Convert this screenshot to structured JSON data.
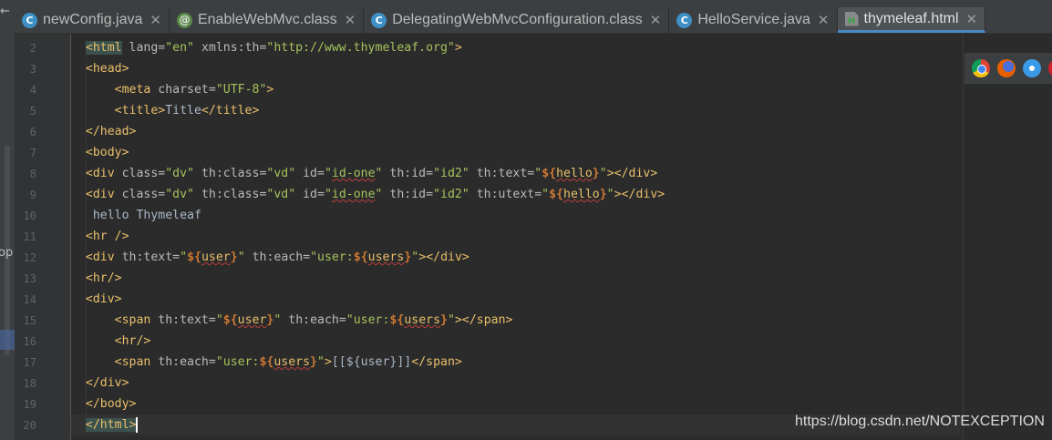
{
  "left_panel": {
    "arrow": "←",
    "cut_text": "op"
  },
  "tabs": [
    {
      "icon": "C",
      "icon_type": "class-c",
      "label": "newConfig.java",
      "close": "✕",
      "active": false
    },
    {
      "icon": "@",
      "icon_type": "anno",
      "label": "EnableWebMvc.class",
      "close": "✕",
      "active": false
    },
    {
      "icon": "C",
      "icon_type": "class-c",
      "label": "DelegatingWebMvcConfiguration.class",
      "close": "✕",
      "active": false
    },
    {
      "icon": "C",
      "icon_type": "class-c",
      "label": "HelloService.java",
      "close": "✕",
      "active": false
    },
    {
      "icon": "H",
      "icon_type": "html-h",
      "label": "thymeleaf.html",
      "close": "✕",
      "active": true
    }
  ],
  "editor": {
    "lines": [
      {
        "no": "2",
        "indent": 1,
        "tokens": [
          [
            "tag",
            "<html"
          ],
          [
            "attr",
            " lang="
          ],
          [
            "val",
            "\"en\""
          ],
          [
            "attr",
            " xmlns:th="
          ],
          [
            "val",
            "\"http://www.thymeleaf.org\""
          ],
          [
            "tag",
            ">"
          ]
        ],
        "match": 0
      },
      {
        "no": "3",
        "indent": 1,
        "tokens": [
          [
            "tag",
            "<head>"
          ]
        ]
      },
      {
        "no": "4",
        "indent": 2,
        "tokens": [
          [
            "tag",
            "<meta"
          ],
          [
            "attr",
            " charset="
          ],
          [
            "val",
            "\"UTF-8\""
          ],
          [
            "tag",
            ">"
          ]
        ]
      },
      {
        "no": "5",
        "indent": 2,
        "tokens": [
          [
            "tag",
            "<title>"
          ],
          [
            "txt",
            "Title"
          ],
          [
            "tag",
            "</title>"
          ]
        ]
      },
      {
        "no": "6",
        "indent": 1,
        "tokens": [
          [
            "tag",
            "</head>"
          ]
        ]
      },
      {
        "no": "7",
        "indent": 1,
        "tokens": [
          [
            "tag",
            "<body>"
          ]
        ]
      },
      {
        "no": "8",
        "indent": 1,
        "tokens": [
          [
            "tag",
            "<div"
          ],
          [
            "attr",
            " class="
          ],
          [
            "val",
            "\"dv\""
          ],
          [
            "attr",
            " th:class="
          ],
          [
            "val",
            "\"vd\""
          ],
          [
            "attr",
            " id="
          ],
          [
            "val",
            "\""
          ],
          [
            "err",
            "id-one"
          ],
          [
            "val",
            "\""
          ],
          [
            "attr",
            " th:id="
          ],
          [
            "val",
            "\"id2\""
          ],
          [
            "attr",
            " th:text="
          ],
          [
            "val",
            "\""
          ],
          [
            "expr",
            "${"
          ],
          [
            "var",
            "hello"
          ],
          [
            "expr",
            "}"
          ],
          [
            "val",
            "\""
          ],
          [
            "tag",
            "></div>"
          ]
        ]
      },
      {
        "no": "9",
        "indent": 1,
        "tokens": [
          [
            "tag",
            "<div"
          ],
          [
            "attr",
            " class="
          ],
          [
            "val",
            "\"dv\""
          ],
          [
            "attr",
            " th:class="
          ],
          [
            "val",
            "\"vd\""
          ],
          [
            "attr",
            " id="
          ],
          [
            "val",
            "\""
          ],
          [
            "err",
            "id-one"
          ],
          [
            "val",
            "\""
          ],
          [
            "attr",
            " th:id="
          ],
          [
            "val",
            "\"id2\""
          ],
          [
            "attr",
            " th:utext="
          ],
          [
            "val",
            "\""
          ],
          [
            "expr",
            "${"
          ],
          [
            "var",
            "hello"
          ],
          [
            "expr",
            "}"
          ],
          [
            "val",
            "\""
          ],
          [
            "tag",
            "></div>"
          ]
        ]
      },
      {
        "no": "10",
        "indent": 1,
        "tokens": [
          [
            "txt",
            " hello Thymeleaf"
          ]
        ]
      },
      {
        "no": "11",
        "indent": 1,
        "tokens": [
          [
            "tag",
            "<hr />"
          ]
        ]
      },
      {
        "no": "12",
        "indent": 1,
        "tokens": [
          [
            "tag",
            "<div"
          ],
          [
            "attr",
            " th:text="
          ],
          [
            "val",
            "\""
          ],
          [
            "expr",
            "${"
          ],
          [
            "var",
            "user"
          ],
          [
            "expr",
            "}"
          ],
          [
            "val",
            "\""
          ],
          [
            "attr",
            " th:each="
          ],
          [
            "val",
            "\"user:"
          ],
          [
            "expr",
            "${"
          ],
          [
            "var",
            "users"
          ],
          [
            "expr",
            "}"
          ],
          [
            "val",
            "\""
          ],
          [
            "tag",
            "></div>"
          ]
        ]
      },
      {
        "no": "13",
        "indent": 1,
        "tokens": [
          [
            "tag",
            "<hr/>"
          ]
        ]
      },
      {
        "no": "14",
        "indent": 1,
        "tokens": [
          [
            "tag",
            "<div>"
          ]
        ]
      },
      {
        "no": "15",
        "indent": 2,
        "tokens": [
          [
            "tag",
            "<span"
          ],
          [
            "attr",
            " th:text="
          ],
          [
            "val",
            "\""
          ],
          [
            "expr",
            "${"
          ],
          [
            "var",
            "user"
          ],
          [
            "expr",
            "}"
          ],
          [
            "val",
            "\""
          ],
          [
            "attr",
            " th:each="
          ],
          [
            "val",
            "\"user:"
          ],
          [
            "expr",
            "${"
          ],
          [
            "var",
            "users"
          ],
          [
            "expr",
            "}"
          ],
          [
            "val",
            "\""
          ],
          [
            "tag",
            "></span>"
          ]
        ]
      },
      {
        "no": "16",
        "indent": 2,
        "tokens": [
          [
            "tag",
            "<hr/>"
          ]
        ]
      },
      {
        "no": "17",
        "indent": 2,
        "tokens": [
          [
            "tag",
            "<span"
          ],
          [
            "attr",
            " th:each="
          ],
          [
            "val",
            "\"user:"
          ],
          [
            "expr",
            "${"
          ],
          [
            "var",
            "users"
          ],
          [
            "expr",
            "}"
          ],
          [
            "val",
            "\""
          ],
          [
            "tag",
            ">"
          ],
          [
            "txt",
            "[[${user}]]"
          ],
          [
            "tag",
            "</span>"
          ]
        ]
      },
      {
        "no": "18",
        "indent": 1,
        "tokens": [
          [
            "tag",
            "</div>"
          ]
        ]
      },
      {
        "no": "19",
        "indent": 1,
        "tokens": [
          [
            "tag",
            "</body>"
          ]
        ]
      },
      {
        "no": "20",
        "indent": 1,
        "tokens": [
          [
            "tag",
            "</html>"
          ]
        ],
        "current": true,
        "match": 0,
        "caret": true
      }
    ]
  },
  "watermark": "https://blog.csdn.net/NOTEXCEPTION"
}
